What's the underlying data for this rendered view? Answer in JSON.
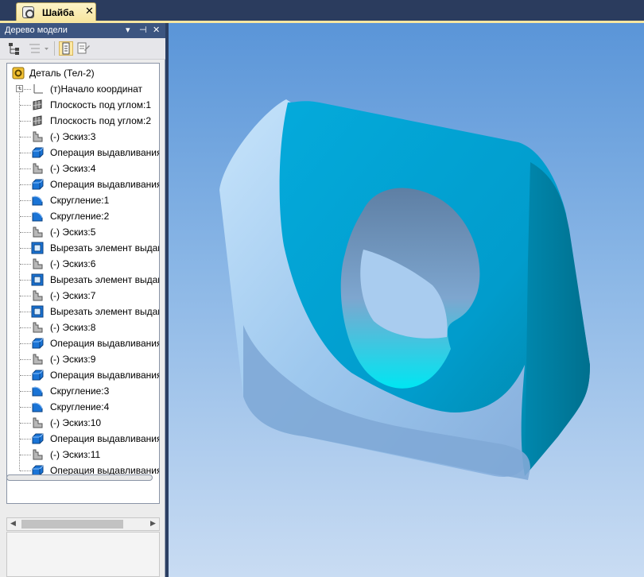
{
  "document_tab": {
    "title": "Шайба",
    "close": "✕"
  },
  "model_tree": {
    "title": "Дерево модели",
    "pin": "⊣",
    "close": "✕",
    "menu": "▾",
    "root": "Деталь (Тел-2)",
    "items": [
      {
        "label": "(т)Начало координат",
        "icon": "origin-icon"
      },
      {
        "label": "Плоскость под углом:1",
        "icon": "plane-icon"
      },
      {
        "label": "Плоскость под углом:2",
        "icon": "plane-icon"
      },
      {
        "label": "(-) Эскиз:3",
        "icon": "sketch-icon"
      },
      {
        "label": "Операция выдавливания",
        "icon": "extrude-icon"
      },
      {
        "label": "(-) Эскиз:4",
        "icon": "sketch-icon"
      },
      {
        "label": "Операция выдавливания",
        "icon": "extrude-icon"
      },
      {
        "label": "Скругление:1",
        "icon": "fillet-icon"
      },
      {
        "label": "Скругление:2",
        "icon": "fillet-icon"
      },
      {
        "label": "(-) Эскиз:5",
        "icon": "sketch-icon"
      },
      {
        "label": "Вырезать элемент выдав.",
        "icon": "cut-extrude-icon"
      },
      {
        "label": "(-) Эскиз:6",
        "icon": "sketch-icon"
      },
      {
        "label": "Вырезать элемент выдав.",
        "icon": "cut-extrude-icon"
      },
      {
        "label": "(-) Эскиз:7",
        "icon": "sketch-icon"
      },
      {
        "label": "Вырезать элемент выдав.",
        "icon": "cut-extrude-icon"
      },
      {
        "label": "(-) Эскиз:8",
        "icon": "sketch-icon"
      },
      {
        "label": "Операция выдавливания",
        "icon": "extrude-icon"
      },
      {
        "label": "(-) Эскиз:9",
        "icon": "sketch-icon"
      },
      {
        "label": "Операция выдавливания",
        "icon": "extrude-icon"
      },
      {
        "label": "Скругление:3",
        "icon": "fillet-icon"
      },
      {
        "label": "Скругление:4",
        "icon": "fillet-icon"
      },
      {
        "label": "(-) Эскиз:10",
        "icon": "sketch-icon"
      },
      {
        "label": "Операция выдавливания",
        "icon": "extrude-icon"
      },
      {
        "label": "(-) Эскиз:11",
        "icon": "sketch-icon"
      },
      {
        "label": "Операция выдавливания",
        "icon": "extrude-icon"
      }
    ]
  },
  "colors": {
    "title_bar": "#3c5580",
    "tab_active": "#f7e6a0",
    "viewport_top": "#5a95d8",
    "viewport_bottom": "#c9dcf3",
    "part_front": "#00a8d8",
    "part_side": "#8ab3dc"
  }
}
